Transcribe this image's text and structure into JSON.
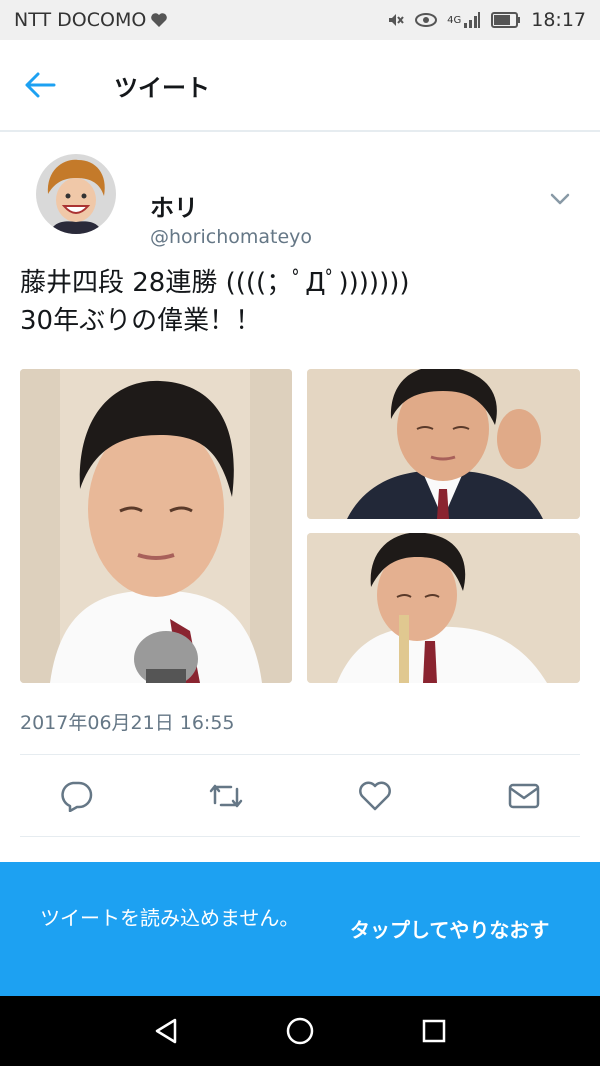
{
  "status_bar": {
    "carrier": "NTT DOCOMO",
    "network": "4G",
    "time": "18:17"
  },
  "header": {
    "title": "ツイート"
  },
  "tweet": {
    "author": {
      "display_name": "ホリ",
      "handle": "@horichomateyo"
    },
    "text_lines": [
      "藤井四段 28連勝 ((((；ﾟДﾟ)))))))",
      "30年ぶりの偉業！！"
    ],
    "timestamp": "2017年06月21日 16:55",
    "photo_count": 3
  },
  "actions": [
    "reply-icon",
    "retweet-icon",
    "like-icon",
    "message-icon"
  ],
  "banner": {
    "message": "ツイートを読み込めません。",
    "retry_label": "タップしてやりなおす"
  },
  "colors": {
    "accent": "#1da1f2",
    "text": "#14171a",
    "secondary_text": "#657786",
    "divider": "#e6ecf0",
    "statusbar_bg": "#f0f0f0",
    "navbar_bg": "#000000"
  }
}
